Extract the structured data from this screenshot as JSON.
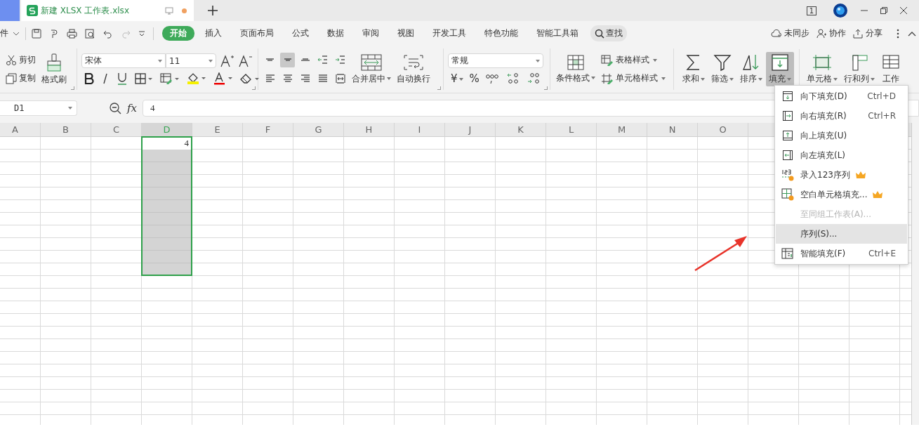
{
  "tab": {
    "title": "新建 XLSX 工作表.xlsx",
    "unsaved": true
  },
  "title_bar": {
    "badge": "1"
  },
  "menu": {
    "cut_label": "件",
    "tabs": [
      {
        "label": "开始",
        "selected": true
      },
      {
        "label": "插入",
        "selected": false
      },
      {
        "label": "页面布局",
        "selected": false
      },
      {
        "label": "公式",
        "selected": false
      },
      {
        "label": "数据",
        "selected": false
      },
      {
        "label": "审阅",
        "selected": false
      },
      {
        "label": "视图",
        "selected": false
      },
      {
        "label": "开发工具",
        "selected": false
      },
      {
        "label": "特色功能",
        "selected": false
      },
      {
        "label": "智能工具箱",
        "selected": false
      }
    ],
    "search": "查找",
    "actions": [
      {
        "kind": "cloud",
        "label": "未同步"
      },
      {
        "kind": "people",
        "label": "协作"
      },
      {
        "kind": "share",
        "label": "分享"
      }
    ]
  },
  "ribbon": {
    "clipboard": {
      "cut": "剪切",
      "copy": "复制",
      "painter": "格式刷"
    },
    "font": {
      "name": "宋体",
      "size": "11"
    },
    "align_buttons": [
      {
        "kind": "top",
        "selected": false
      },
      {
        "kind": "middle",
        "selected": true
      },
      {
        "kind": "bottom",
        "selected": false
      },
      {
        "kind": "outdent",
        "selected": false
      },
      {
        "kind": "indent",
        "selected": false
      },
      {
        "kind": "left",
        "selected": false
      },
      {
        "kind": "center",
        "selected": false
      },
      {
        "kind": "right",
        "selected": false
      },
      {
        "kind": "justify",
        "selected": false
      },
      {
        "kind": "distribute",
        "selected": false
      }
    ],
    "merge": "合并居中",
    "wrap": "自动换行",
    "number": {
      "format": "常规",
      "currency": "¥",
      "percent": "%"
    },
    "styles": {
      "conditional": "条件格式",
      "table": "表格样式",
      "cell": "单元格样式"
    },
    "tools": [
      {
        "kind": "sum",
        "label": "求和",
        "selected": false
      },
      {
        "kind": "filter",
        "label": "筛选",
        "selected": false
      },
      {
        "kind": "sort",
        "label": "排序",
        "selected": false
      },
      {
        "kind": "fill",
        "label": "填充",
        "selected": true
      },
      {
        "kind": "cell",
        "label": "单元格",
        "selected": false
      },
      {
        "kind": "rowcol",
        "label": "行和列",
        "selected": false
      },
      {
        "kind": "sheet",
        "label": "工作",
        "selected": false
      }
    ]
  },
  "formula_bar": {
    "name_box": "D1",
    "fx": "fx",
    "value": "4"
  },
  "sheet": {
    "columns": [
      {
        "label": "A",
        "selected": false
      },
      {
        "label": "B",
        "selected": false
      },
      {
        "label": "C",
        "selected": false
      },
      {
        "label": "D",
        "selected": true,
        "cells": [
          {
            "value": "4",
            "active": true
          },
          {
            "selected": true
          },
          {
            "selected": true
          },
          {
            "selected": true
          },
          {
            "selected": true
          },
          {
            "selected": true
          },
          {
            "selected": true
          },
          {
            "selected": true
          },
          {
            "selected": true
          },
          {
            "selected": true
          },
          {
            "selected": true
          }
        ]
      },
      {
        "label": "E",
        "selected": false
      },
      {
        "label": "F",
        "selected": false
      },
      {
        "label": "G",
        "selected": false
      },
      {
        "label": "H",
        "selected": false
      },
      {
        "label": "I",
        "selected": false
      },
      {
        "label": "J",
        "selected": false
      },
      {
        "label": "K",
        "selected": false
      },
      {
        "label": "L",
        "selected": false
      },
      {
        "label": "M",
        "selected": false
      },
      {
        "label": "N",
        "selected": false
      },
      {
        "label": "O",
        "selected": false
      }
    ]
  },
  "fill_menu": {
    "items": [
      {
        "kind": "down",
        "label": "向下填充(D)",
        "shortcut": "Ctrl+D",
        "disabled": false,
        "selected": false,
        "premium": false
      },
      {
        "kind": "right",
        "label": "向右填充(R)",
        "shortcut": "Ctrl+R",
        "disabled": false,
        "selected": false,
        "premium": false
      },
      {
        "kind": "up",
        "label": "向上填充(U)",
        "disabled": false,
        "selected": false,
        "premium": false
      },
      {
        "kind": "left",
        "label": "向左填充(L)",
        "disabled": false,
        "selected": false,
        "premium": false
      },
      {
        "kind": "sequence123",
        "label": "录入123序列",
        "disabled": false,
        "selected": false,
        "premium": true
      },
      {
        "kind": "blank",
        "label": "空白单元格填充...",
        "disabled": false,
        "selected": false,
        "premium": true
      },
      {
        "kind": "none",
        "label": "至同组工作表(A)...",
        "disabled": true,
        "selected": false,
        "premium": false
      },
      {
        "kind": "none",
        "label": "序列(S)...",
        "disabled": false,
        "selected": true,
        "premium": false
      },
      {
        "kind": "smart",
        "label": "智能填充(F)",
        "shortcut": "Ctrl+E",
        "disabled": false,
        "selected": false,
        "premium": false
      }
    ]
  }
}
